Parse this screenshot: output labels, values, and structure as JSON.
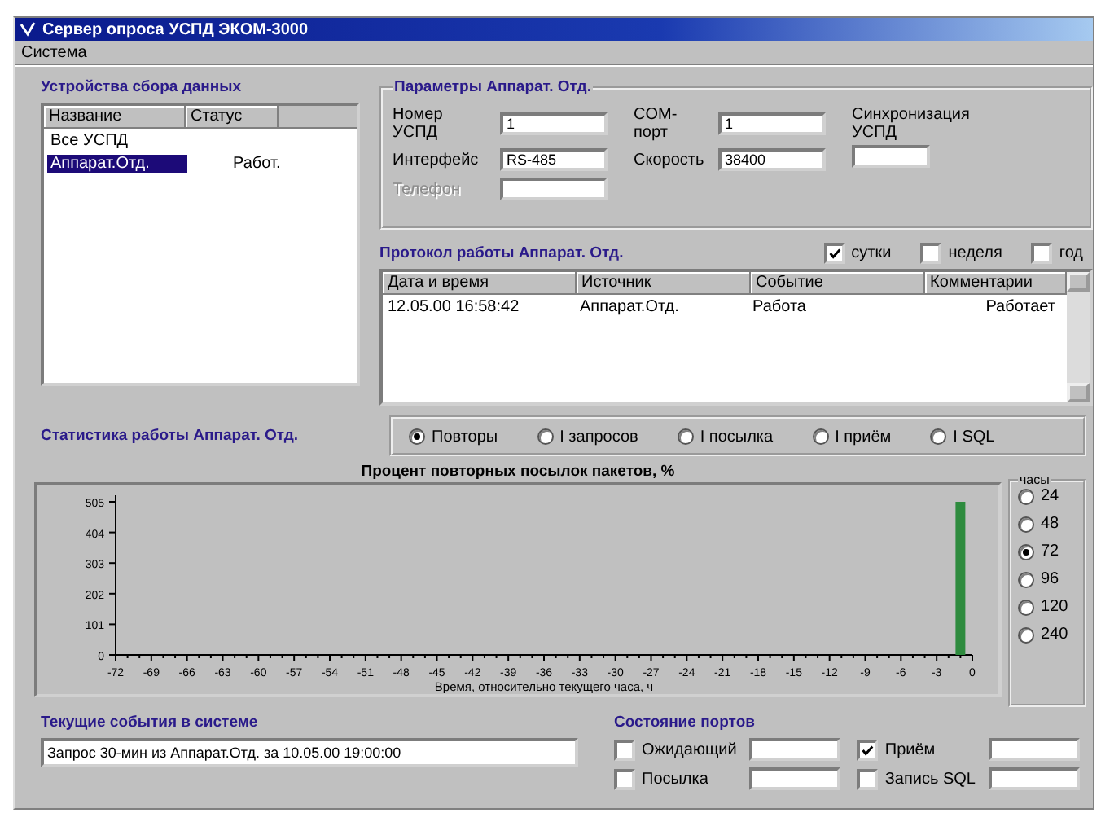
{
  "window": {
    "title": "Сервер опроса УСПД ЭКОМ-3000"
  },
  "menu": [
    "Система"
  ],
  "devices": {
    "title": "Устройства сбора данных",
    "columns": [
      "Название",
      "Статус"
    ],
    "items": [
      {
        "name": "Все УСПД",
        "selected": false
      },
      {
        "name": "Аппарат.Отд.",
        "status": "Работ.",
        "selected": true
      }
    ]
  },
  "parameters": {
    "title": "Параметры Аппарат. Отд.",
    "columns": [
      [
        {
          "label": "Номер УСПД",
          "value": "1",
          "disabled": false
        },
        {
          "label": "Интерфейс",
          "value": "RS-485",
          "disabled": false
        },
        {
          "label": "Телефон",
          "disabled": true
        }
      ],
      [
        {
          "label": "COM-порт",
          "value": "1",
          "disabled": false
        },
        {
          "label": "Скорость",
          "value": "38400",
          "disabled": false
        }
      ],
      [
        {
          "label": "Синхронизация УСПД",
          "disabled": false
        }
      ]
    ]
  },
  "log": {
    "title": "Протокол работы Аппарат. Отд.",
    "periods": [
      {
        "label": "сутки",
        "checked": true
      },
      {
        "label": "неделя",
        "checked": false
      },
      {
        "label": "год",
        "checked": false
      }
    ],
    "columns": [
      "Дата и время",
      "Источник",
      "Событие",
      "Комментарии"
    ],
    "rows": [
      [
        "12.05.00 16:58:42",
        "Аппарат.Отд.",
        "Работа",
        "Работает"
      ]
    ]
  },
  "statistics": {
    "title": "Статистика работы Аппарат. Отд.",
    "options": [
      {
        "label": "Повторы",
        "selected": true
      },
      {
        "label": "I запросов",
        "selected": false
      },
      {
        "label": "I посылка",
        "selected": false
      },
      {
        "label": "I приём",
        "selected": false
      },
      {
        "label": "I SQL",
        "selected": false
      }
    ]
  },
  "chart": {
    "chart_data": {
      "type": "bar",
      "title": "Процент повторных посылок пакетов, %",
      "xlabel": "Время, относительно текущего часа, ч",
      "x": [
        -1
      ],
      "values": [
        505
      ],
      "xlim": [
        -72,
        0
      ],
      "ylim": [
        0,
        505
      ],
      "xticks": [
        -72,
        -69,
        -66,
        -63,
        -60,
        -57,
        -54,
        -51,
        -48,
        -45,
        -42,
        -39,
        -36,
        -33,
        -30,
        -27,
        -24,
        -21,
        -18,
        -15,
        -12,
        -9,
        -6,
        -3,
        0
      ],
      "yticks": [
        0,
        101,
        202,
        303,
        404,
        505
      ]
    }
  },
  "hours": {
    "title": "часы",
    "options": [
      {
        "label": "24",
        "selected": false
      },
      {
        "label": "48",
        "selected": false
      },
      {
        "label": "72",
        "selected": true
      },
      {
        "label": "96",
        "selected": false
      },
      {
        "label": "120",
        "selected": false
      },
      {
        "label": "240",
        "selected": false
      }
    ]
  },
  "events": {
    "title": "Текущие события в системе",
    "value": "Запрос 30-мин из Аппарат.Отд. за 10.05.00 19:00:00"
  },
  "ports": {
    "title": "Состояние портов",
    "items": [
      {
        "label": "Ожидающий",
        "checked": false
      },
      {
        "label": "Приём",
        "checked": true
      },
      {
        "label": "Посылка",
        "checked": false
      },
      {
        "label": "Запись SQL",
        "checked": false
      }
    ]
  }
}
